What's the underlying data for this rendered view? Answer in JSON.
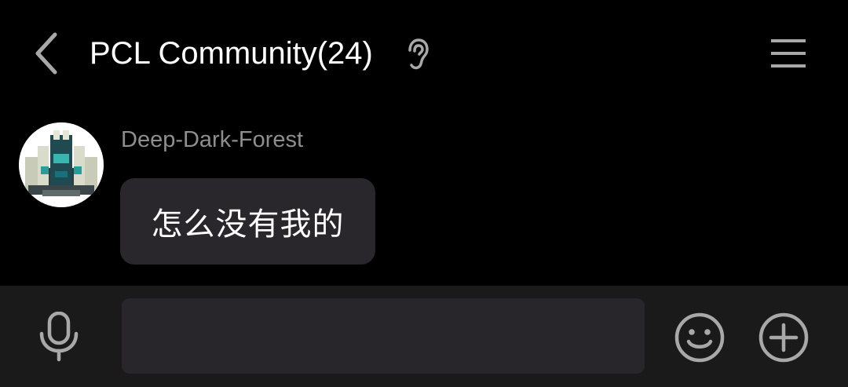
{
  "header": {
    "title": "PCL Community(24)",
    "back_icon": "chevron-left-icon",
    "listen_icon": "ear-icon",
    "menu_icon": "menu-icon"
  },
  "messages": [
    {
      "sender": "Deep-Dark-Forest",
      "avatar_icon": "warden-avatar",
      "text": "怎么没有我的"
    }
  ],
  "input_bar": {
    "voice_icon": "microphone-icon",
    "input_value": "",
    "emoji_icon": "smiley-icon",
    "more_icon": "plus-circle-icon"
  },
  "colors": {
    "background": "#000000",
    "bubble": "#2a272c",
    "input_bar": "#1a1a1a",
    "input_field": "#29262b",
    "icon": "#a8a8a8",
    "sender_text": "#8e8e8e"
  }
}
